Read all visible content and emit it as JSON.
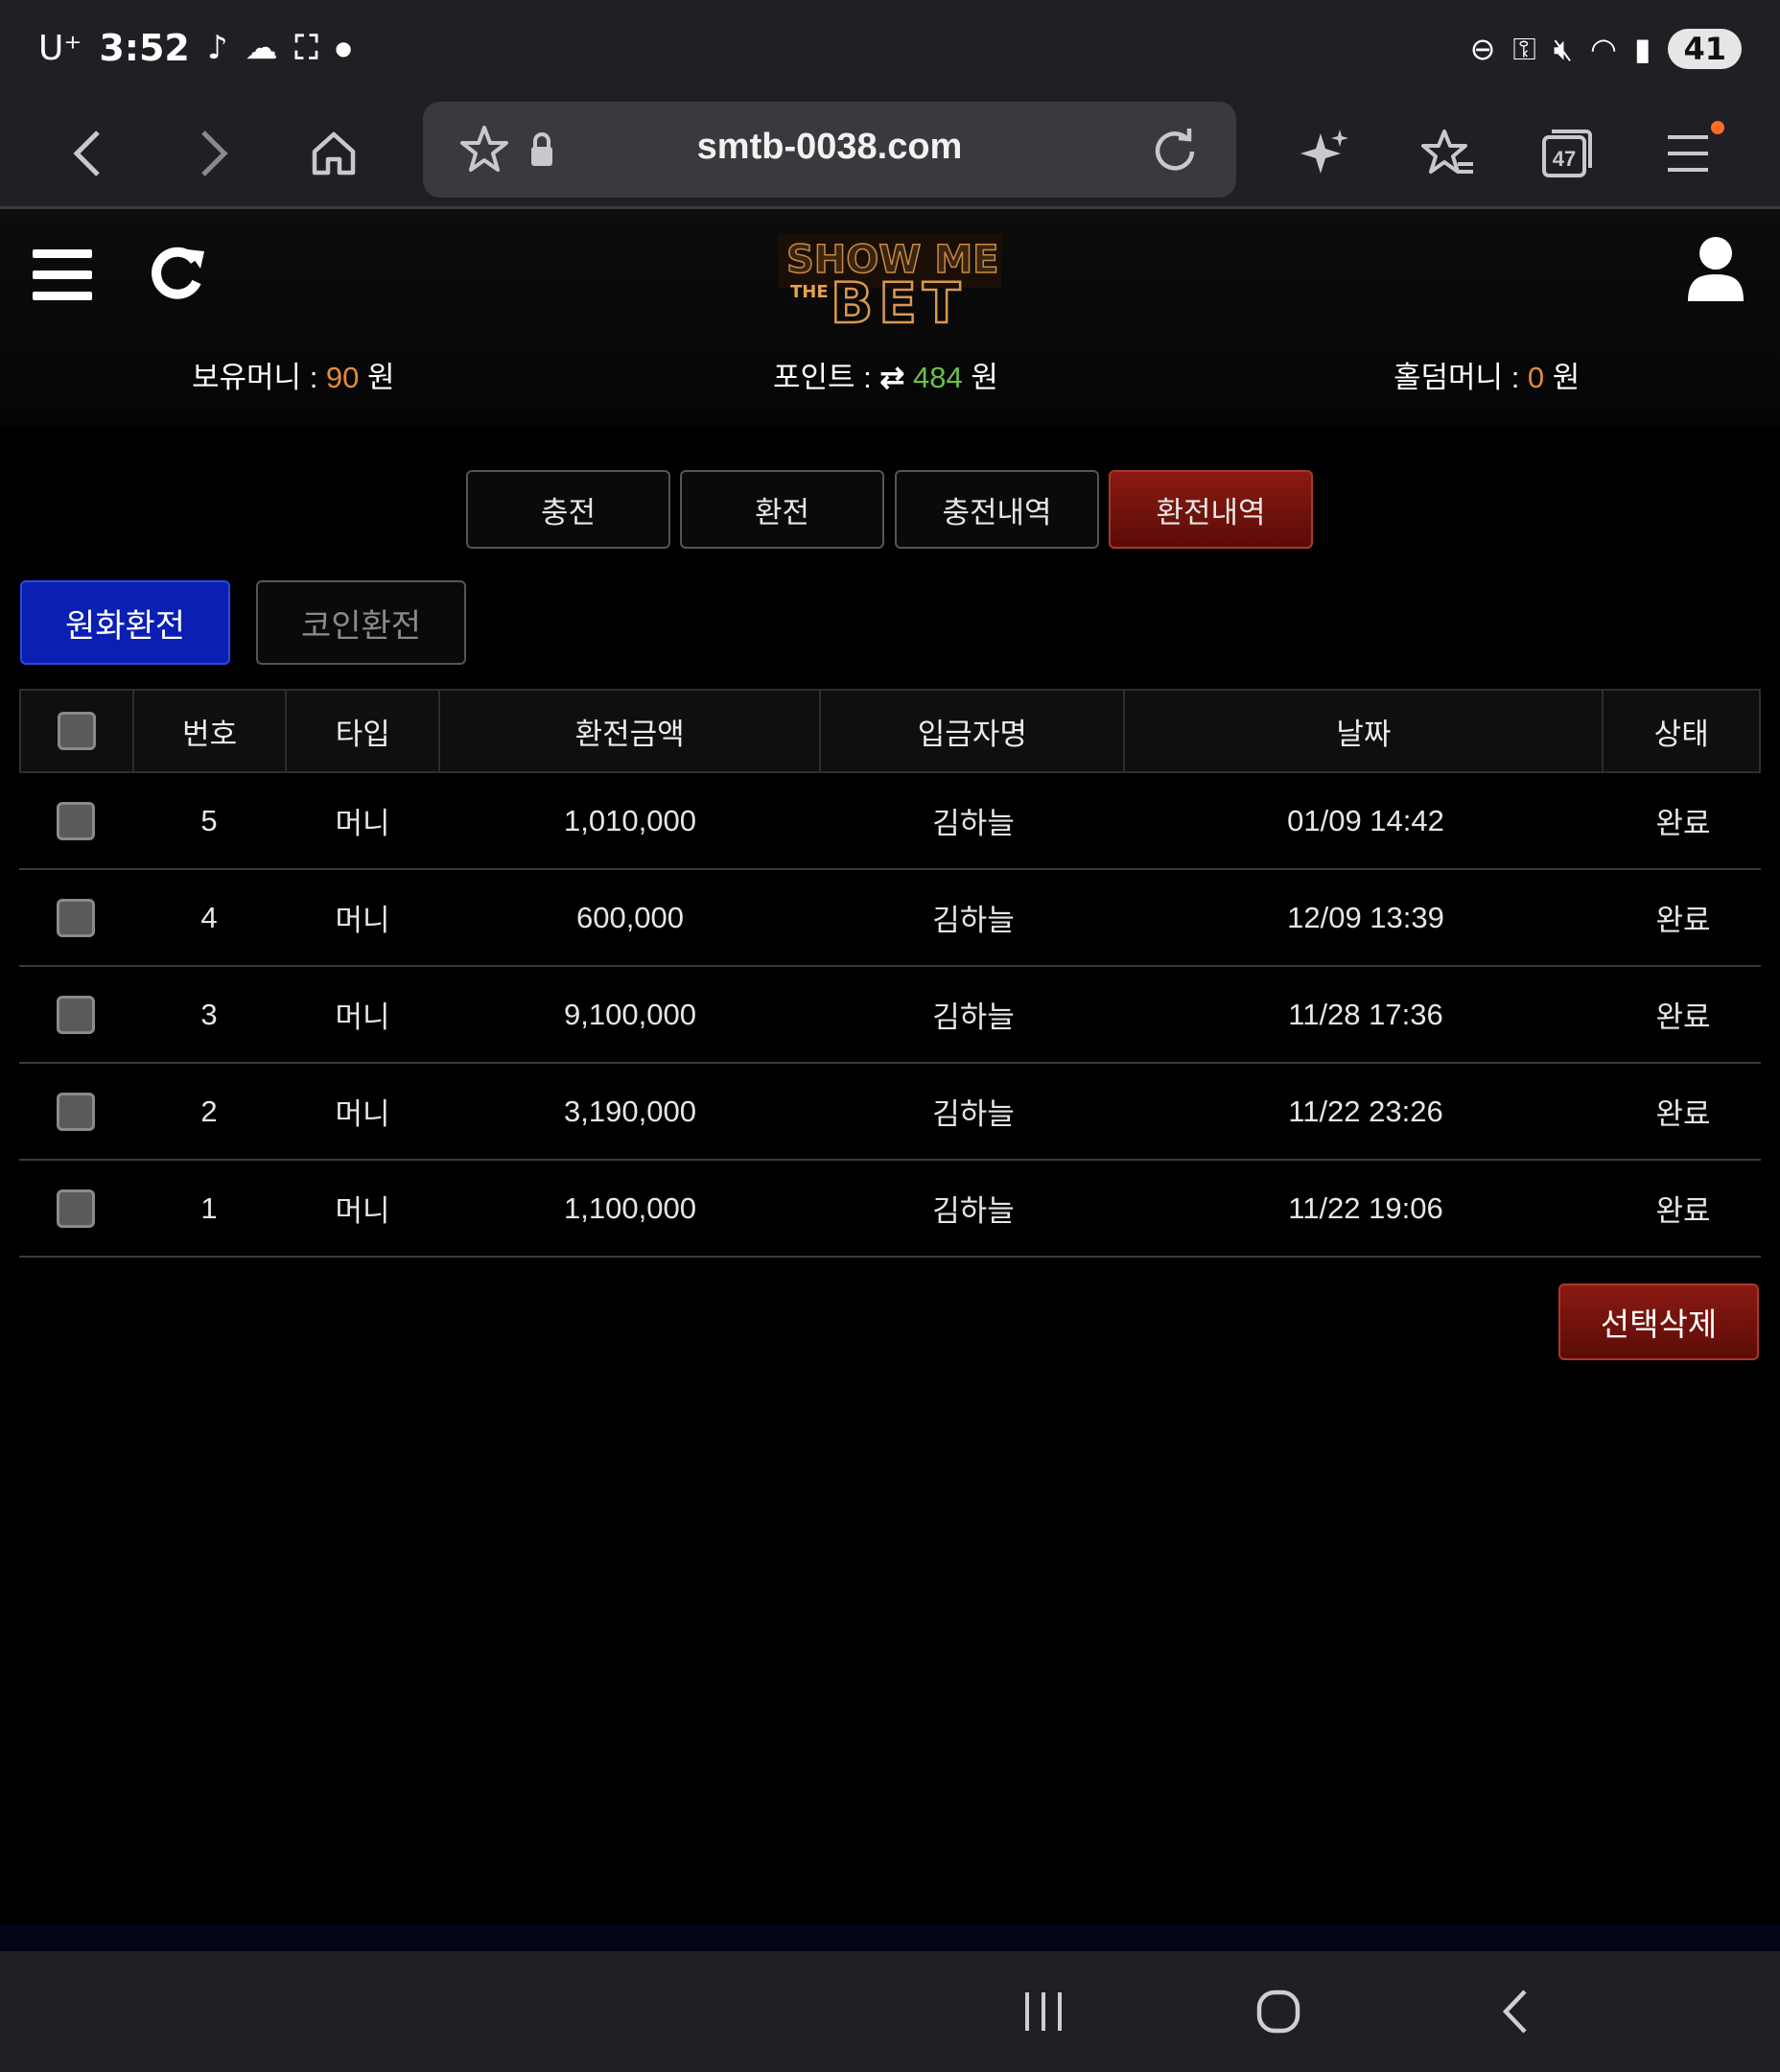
{
  "status_bar": {
    "carrier": "U⁺",
    "time": "3:52",
    "battery": "41"
  },
  "browser": {
    "url": "smtb-0038.com",
    "tab_count": "47"
  },
  "header": {
    "logo_text_top": "SHOW ME",
    "logo_text_the": "THE",
    "logo_text_bottom": "BET",
    "balances": [
      {
        "label": "보유머니 : ",
        "value": "90",
        "unit": " 원"
      },
      {
        "label": "포인트 : ",
        "value": "484",
        "unit": " 원"
      },
      {
        "label": "홀덤머니 : ",
        "value": "0",
        "unit": " 원"
      }
    ]
  },
  "tabs": [
    {
      "label": "충전",
      "active": false
    },
    {
      "label": "환전",
      "active": false
    },
    {
      "label": "충전내역",
      "active": false
    },
    {
      "label": "환전내역",
      "active": true
    }
  ],
  "subtabs": [
    {
      "label": "원화환전",
      "active": true
    },
    {
      "label": "코인환전",
      "active": false
    }
  ],
  "table": {
    "headers": [
      "번호",
      "타입",
      "환전금액",
      "입금자명",
      "날짜",
      "상태"
    ],
    "rows": [
      {
        "no": "5",
        "type": "머니",
        "amount": "1,010,000",
        "name": "김하늘",
        "date": "01/09 14:42",
        "status": "완료"
      },
      {
        "no": "4",
        "type": "머니",
        "amount": "600,000",
        "name": "김하늘",
        "date": "12/09 13:39",
        "status": "완료"
      },
      {
        "no": "3",
        "type": "머니",
        "amount": "9,100,000",
        "name": "김하늘",
        "date": "11/28 17:36",
        "status": "완료"
      },
      {
        "no": "2",
        "type": "머니",
        "amount": "3,190,000",
        "name": "김하늘",
        "date": "11/22 23:26",
        "status": "완료"
      },
      {
        "no": "1",
        "type": "머니",
        "amount": "1,100,000",
        "name": "김하늘",
        "date": "11/22 19:06",
        "status": "완료"
      }
    ]
  },
  "actions": {
    "delete_selected": "선택삭제"
  },
  "colors": {
    "active_tab": "#7a160f",
    "active_subtab": "#0b1fb3",
    "money_value": "#e28a3c",
    "point_value": "#6cc04a"
  }
}
